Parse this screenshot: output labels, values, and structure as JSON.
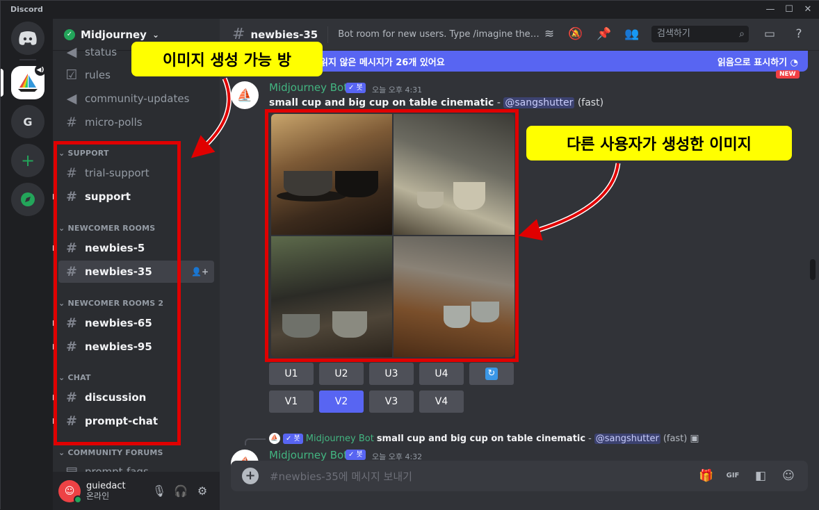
{
  "window": {
    "app_name": "Discord"
  },
  "servers": [
    {
      "letter": "G"
    }
  ],
  "guild": {
    "name": "Midjourney"
  },
  "sidebar": {
    "channels_top": [
      {
        "label": "status"
      },
      {
        "label": "rules"
      },
      {
        "label": "community-updates"
      },
      {
        "label": "micro-polls"
      }
    ],
    "categories": {
      "support": "SUPPORT",
      "newcomer": "NEWCOMER ROOMS",
      "newcomer2": "NEWCOMER ROOMS 2",
      "chat": "CHAT",
      "forums": "COMMUNITY FORUMS"
    },
    "channels": {
      "trial_support": "trial-support",
      "support": "support",
      "newbies5": "newbies-5",
      "newbies35": "newbies-35",
      "newbies65": "newbies-65",
      "newbies95": "newbies-95",
      "discussion": "discussion",
      "prompt_chat": "prompt-chat",
      "prompt_faqs": "prompt-faqs"
    }
  },
  "user": {
    "name": "guiedact",
    "status": "온라인"
  },
  "header": {
    "channel": "newbies-35",
    "topic": "Bot room for new users. Type /imagine then de...",
    "search_placeholder": "검색하기"
  },
  "unread_banner": {
    "text": "읽지 않은 메시지가 26개 있어요",
    "mark_read": "읽음으로 표시하기",
    "new_tag": "NEW"
  },
  "message1": {
    "author": "Midjourney Bot",
    "bot_tag": "✓ 봇",
    "timestamp": "오늘 오후 4:31",
    "prompt": "small cup and big cup on table cinematic",
    "separator": " - ",
    "mention": "@sangshutter",
    "mode": "(fast)"
  },
  "buttons": {
    "row1": [
      "U1",
      "U2",
      "U3",
      "U4"
    ],
    "row2": [
      "V1",
      "V2",
      "V3",
      "V4"
    ]
  },
  "reply": {
    "author": "Midjourney Bot",
    "bot_tag": "✓ 봇",
    "prompt": "small cup and big cup on table cinematic",
    "separator": " - ",
    "mention": "@sangshutter",
    "mode": "(fast)"
  },
  "message2": {
    "author": "Midjourney Bot",
    "bot_tag": "✓ 봇",
    "timestamp": "오늘 오후 4:32"
  },
  "composer": {
    "placeholder": "#newbies-35에 메시지 보내기"
  },
  "annotations": {
    "callout_rooms": "이미지 생성 가능 방",
    "callout_images": "다른 사용자가 생성한 이미지"
  },
  "colors": {
    "accent": "#5865f2",
    "annotation_red": "#e00000",
    "callout_yellow": "#ffff00",
    "bot_green": "#43b581"
  }
}
